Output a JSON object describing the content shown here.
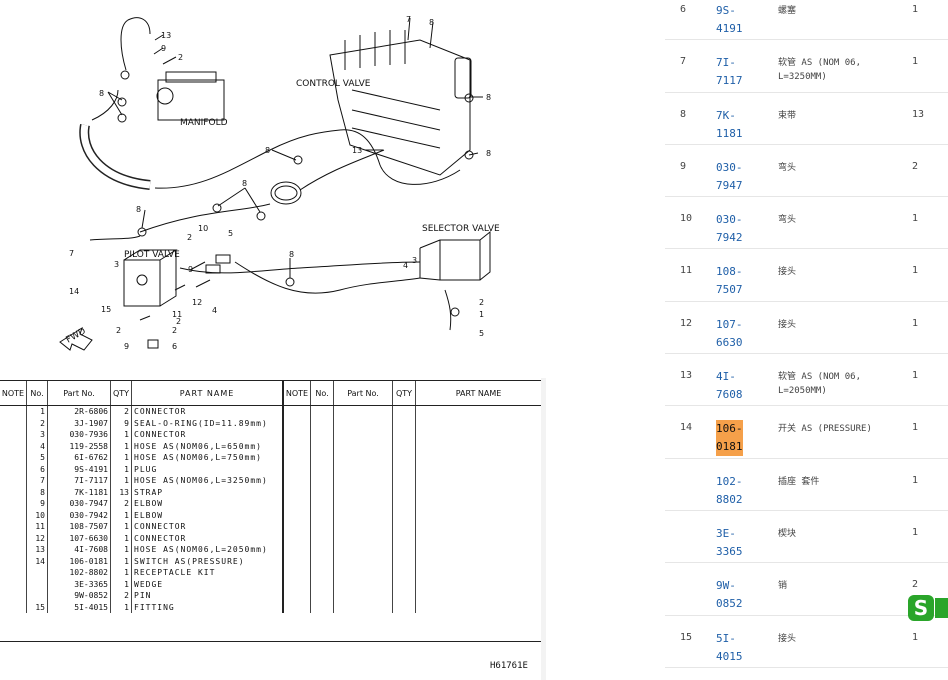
{
  "diagram": {
    "labels": {
      "control_valve": "CONTROL VALVE",
      "manifold": "MANIFOLD",
      "selector_valve": "SELECTOR VALVE",
      "pilot_valve": "PILOT VALVE",
      "fwd": "FWD"
    },
    "drawing_code": "H61761E"
  },
  "table": {
    "headers": {
      "note": "NOTE",
      "no": "No.",
      "part_no": "Part No.",
      "qty": "QTY",
      "part_name": "PART NAME"
    },
    "rows": [
      {
        "no": "1",
        "part": "2R-6806",
        "qty": "2",
        "name": "CONNECTOR"
      },
      {
        "no": "2",
        "part": "3J-1907",
        "qty": "9",
        "name": "SEAL-O-RING(ID=11.89mm)"
      },
      {
        "no": "3",
        "part": "030-7936",
        "qty": "1",
        "name": "CONNECTOR"
      },
      {
        "no": "4",
        "part": "119-2558",
        "qty": "1",
        "name": "HOSE AS(NOM06,L=650mm)"
      },
      {
        "no": "5",
        "part": "6I-6762",
        "qty": "1",
        "name": "HOSE AS(NOM06,L=750mm)"
      },
      {
        "no": "6",
        "part": "9S-4191",
        "qty": "1",
        "name": "PLUG"
      },
      {
        "no": "7",
        "part": "7I-7117",
        "qty": "1",
        "name": "HOSE AS(NOM06,L=3250mm)"
      },
      {
        "no": "8",
        "part": "7K-1181",
        "qty": "13",
        "name": "STRAP"
      },
      {
        "no": "9",
        "part": "030-7947",
        "qty": "2",
        "name": "ELBOW"
      },
      {
        "no": "10",
        "part": "030-7942",
        "qty": "1",
        "name": "ELBOW"
      },
      {
        "no": "11",
        "part": "108-7507",
        "qty": "1",
        "name": "CONNECTOR"
      },
      {
        "no": "12",
        "part": "107-6630",
        "qty": "1",
        "name": "CONNECTOR"
      },
      {
        "no": "13",
        "part": "4I-7608",
        "qty": "1",
        "name": "HOSE AS(NOM06,L=2050mm)"
      },
      {
        "no": "14",
        "part": "106-0181",
        "qty": "1",
        "name": "SWITCH AS(PRESSURE)"
      },
      {
        "no": "",
        "part": "102-8802",
        "qty": "1",
        "name": " RECEPTACLE KIT"
      },
      {
        "no": "",
        "part": "3E-3365",
        "qty": "1",
        "name": " WEDGE"
      },
      {
        "no": "",
        "part": "9W-0852",
        "qty": "2",
        "name": " PIN"
      },
      {
        "no": "15",
        "part": "5I-4015",
        "qty": "1",
        "name": "FITTING"
      }
    ]
  },
  "parts_list": [
    {
      "no": "6",
      "part_l1": "9S-",
      "part_l2": "4191",
      "name": "螺塞",
      "qty": "1",
      "highlight": false
    },
    {
      "no": "7",
      "part_l1": "7I-",
      "part_l2": "7117",
      "name": "软管 AS (NOM 06, L=3250MM)",
      "qty": "1",
      "highlight": false
    },
    {
      "no": "8",
      "part_l1": "7K-",
      "part_l2": "1181",
      "name": "束带",
      "qty": "13",
      "highlight": false
    },
    {
      "no": "9",
      "part_l1": "030-",
      "part_l2": "7947",
      "name": "弯头",
      "qty": "2",
      "highlight": false
    },
    {
      "no": "10",
      "part_l1": "030-",
      "part_l2": "7942",
      "name": "弯头",
      "qty": "1",
      "highlight": false
    },
    {
      "no": "11",
      "part_l1": "108-",
      "part_l2": "7507",
      "name": "接头",
      "qty": "1",
      "highlight": false
    },
    {
      "no": "12",
      "part_l1": "107-",
      "part_l2": "6630",
      "name": "接头",
      "qty": "1",
      "highlight": false
    },
    {
      "no": "13",
      "part_l1": "4I-",
      "part_l2": "7608",
      "name": "软管 AS (NOM 06, L=2050MM)",
      "qty": "1",
      "highlight": false
    },
    {
      "no": "14",
      "part_l1": "106-",
      "part_l2": "0181",
      "name": "开关 AS (PRESSURE)",
      "qty": "1",
      "highlight": true
    },
    {
      "no": "",
      "part_l1": "102-",
      "part_l2": "8802",
      "name": "插座 套件",
      "qty": "1",
      "highlight": false
    },
    {
      "no": "",
      "part_l1": "3E-",
      "part_l2": "3365",
      "name": "楔块",
      "qty": "1",
      "highlight": false
    },
    {
      "no": "",
      "part_l1": "9W-",
      "part_l2": "0852",
      "name": "销",
      "qty": "2",
      "highlight": false
    },
    {
      "no": "15",
      "part_l1": "5I-",
      "part_l2": "4015",
      "name": "接头",
      "qty": "1",
      "highlight": false
    }
  ],
  "colors": {
    "link": "#1f5fa8",
    "highlight": "#f5a04a",
    "logo": "#2aa52a"
  },
  "icons": {
    "app_logo": "sogou-s-icon",
    "fwd_arrow": "fwd-arrow-icon"
  }
}
